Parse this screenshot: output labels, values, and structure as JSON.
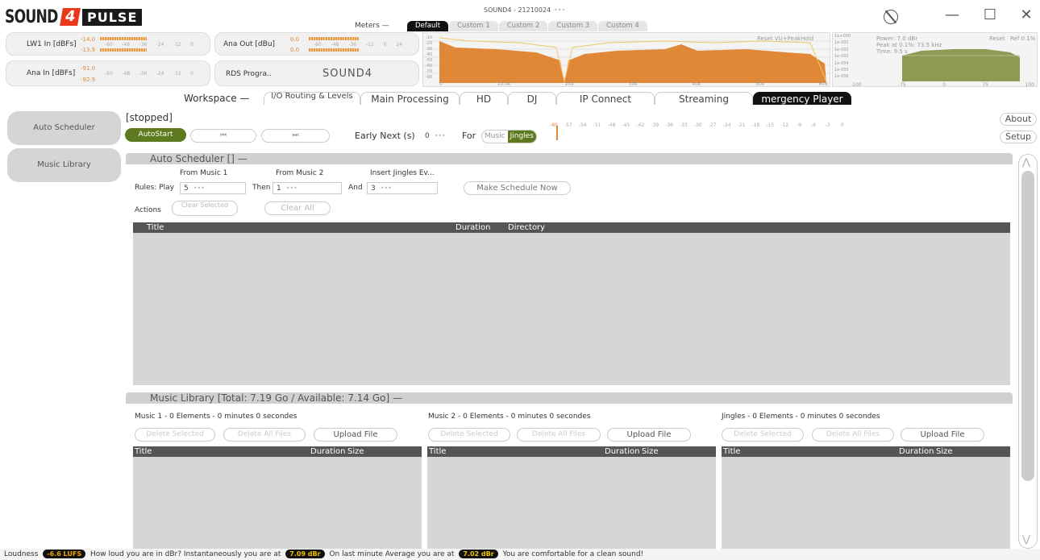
{
  "app": {
    "logo_left": "SOUND",
    "logo_four": "4",
    "logo_right": "PULSE",
    "window_title": "SOUND4 - 21210024",
    "window_title_dots": "•••"
  },
  "window_controls": {
    "minimize": "—",
    "maximize": "☐",
    "close": "✕"
  },
  "meters": {
    "label": "Meters —",
    "tabs": [
      "Default",
      "Custom 1",
      "Custom 2",
      "Custom 3",
      "Custom 4"
    ],
    "lw1": {
      "label": "LW1 In [dBFs]",
      "v1": "-14.0",
      "v2": "-13.9",
      "scale": [
        "-60",
        "-48",
        "-36",
        "-24",
        "-12",
        "0"
      ]
    },
    "ana_in": {
      "label": "Ana In [dBFs]",
      "v1": "-91.0",
      "v2": "-92.9",
      "scale": [
        "-60",
        "-48",
        "-36",
        "-24",
        "-12",
        "0"
      ]
    },
    "ana_out": {
      "label": "Ana Out [dBu]",
      "v1": "0.0",
      "v2": "0.0",
      "scale": [
        "-60",
        "-48",
        "-36",
        "-12",
        "0",
        "24"
      ]
    },
    "rds": {
      "label": "RDS Progra..",
      "value": "SOUND4"
    },
    "spectrum": {
      "reset": "Reset VU+PeakHold",
      "x_ticks": [
        "0",
        "10.0k",
        "20k",
        "30k",
        "40k",
        "50k",
        "60k"
      ],
      "y_ticks": [
        "-10",
        "-20",
        "-30",
        "-40",
        "-50",
        "-60",
        "-70",
        "-80"
      ],
      "fill_color": "#e08838",
      "line_color": "#f2c76a"
    },
    "power": {
      "power": "Power: 7.0 dBr",
      "peak": "Peak at 0.1%: 73.5 kHz",
      "time": "Time: 9.5 s",
      "reset": "Reset",
      "ref": "Ref 0.1%",
      "y_ticks": [
        "1e+000",
        "1e-001",
        "1e-002",
        "1e-003",
        "1e-004",
        "1e-005",
        "1e-006"
      ],
      "x_ticks": [
        "-100",
        "-75",
        "0",
        "75",
        "100"
      ],
      "fill_color": "#8e9a52"
    }
  },
  "workspace": {
    "label": "Workspace —",
    "tabs": [
      "I/O Routing & Levels",
      "Main Processing",
      "HD",
      "DJ",
      "IP Connect",
      "Streaming",
      "mergency Player"
    ],
    "active": "mergency Player"
  },
  "nav": {
    "items": [
      "Auto Scheduler",
      "Music Library"
    ]
  },
  "scheduler": {
    "status": "[stopped]",
    "autostart": "AutoStart",
    "prev": "⏮",
    "next": "⏭",
    "early_next_label": "Early Next (s)",
    "early_next_value": "0",
    "for_label": "For",
    "music_label": "Music",
    "jingles_label": "Jingles",
    "vu_ticks": [
      "-60",
      "-57",
      "-54",
      "-51",
      "-48",
      "-45",
      "-42",
      "-39",
      "-36",
      "-33",
      "-30",
      "-27",
      "-24",
      "-21",
      "-18",
      "-15",
      "-12",
      "-9",
      "-6",
      "-3",
      "0"
    ],
    "about": "About",
    "setup": "Setup"
  },
  "auto_scheduler": {
    "title": "Auto Scheduler []  —",
    "rules_label": "Rules: Play",
    "from_music1_label": "From Music 1",
    "from_music1_value": "5",
    "then_label": "Then",
    "from_music2_label": "From Music 2",
    "from_music2_value": "1",
    "and_label": "And",
    "insert_label": "Insert Jingles Ev...",
    "insert_value": "3",
    "make_schedule": "Make Schedule Now",
    "actions_label": "Actions",
    "clear_selected": "Clear Selected",
    "clear_all": "Clear All",
    "columns": [
      "Title",
      "Duration",
      "Directory"
    ]
  },
  "music_library": {
    "title": "Music Library  [Total: 7.19 Go / Available: 7.14 Go]  —",
    "lists": [
      {
        "title": "Music 1 - 0 Elements - 0 minutes 0 secondes",
        "delete_selected": "Delete Selected",
        "delete_all": "Delete All Files",
        "upload": "Upload File",
        "col_title": "Title",
        "col_duration": "Duration",
        "col_size": "Size"
      },
      {
        "title": "Music 2 - 0 Elements - 0 minutes 0 secondes",
        "delete_selected": "Delete Selected",
        "delete_all": "Delete All Files",
        "upload": "Upload File",
        "col_title": "Title",
        "col_duration": "Duration",
        "col_size": "Size"
      },
      {
        "title": "Jingles - 0 Elements - 0 minutes 0 secondes",
        "delete_selected": "Delete Selected",
        "delete_all": "Delete All Files",
        "upload": "Upload File",
        "col_title": "Title",
        "col_duration": "Duration",
        "col_size": "Size"
      }
    ]
  },
  "footer": {
    "loudness": "Loudness",
    "lufs": "-6.6 LUFS",
    "text1": "How loud you are in dBr? Instantaneously you are at",
    "inst": "7.09 dBr",
    "text2": "On last minute Average you are at",
    "avg": "7.02 dBr",
    "text3": "You are comfortable for a clean sound!"
  },
  "scroll": {
    "up": "⋀",
    "down": "⋁"
  }
}
